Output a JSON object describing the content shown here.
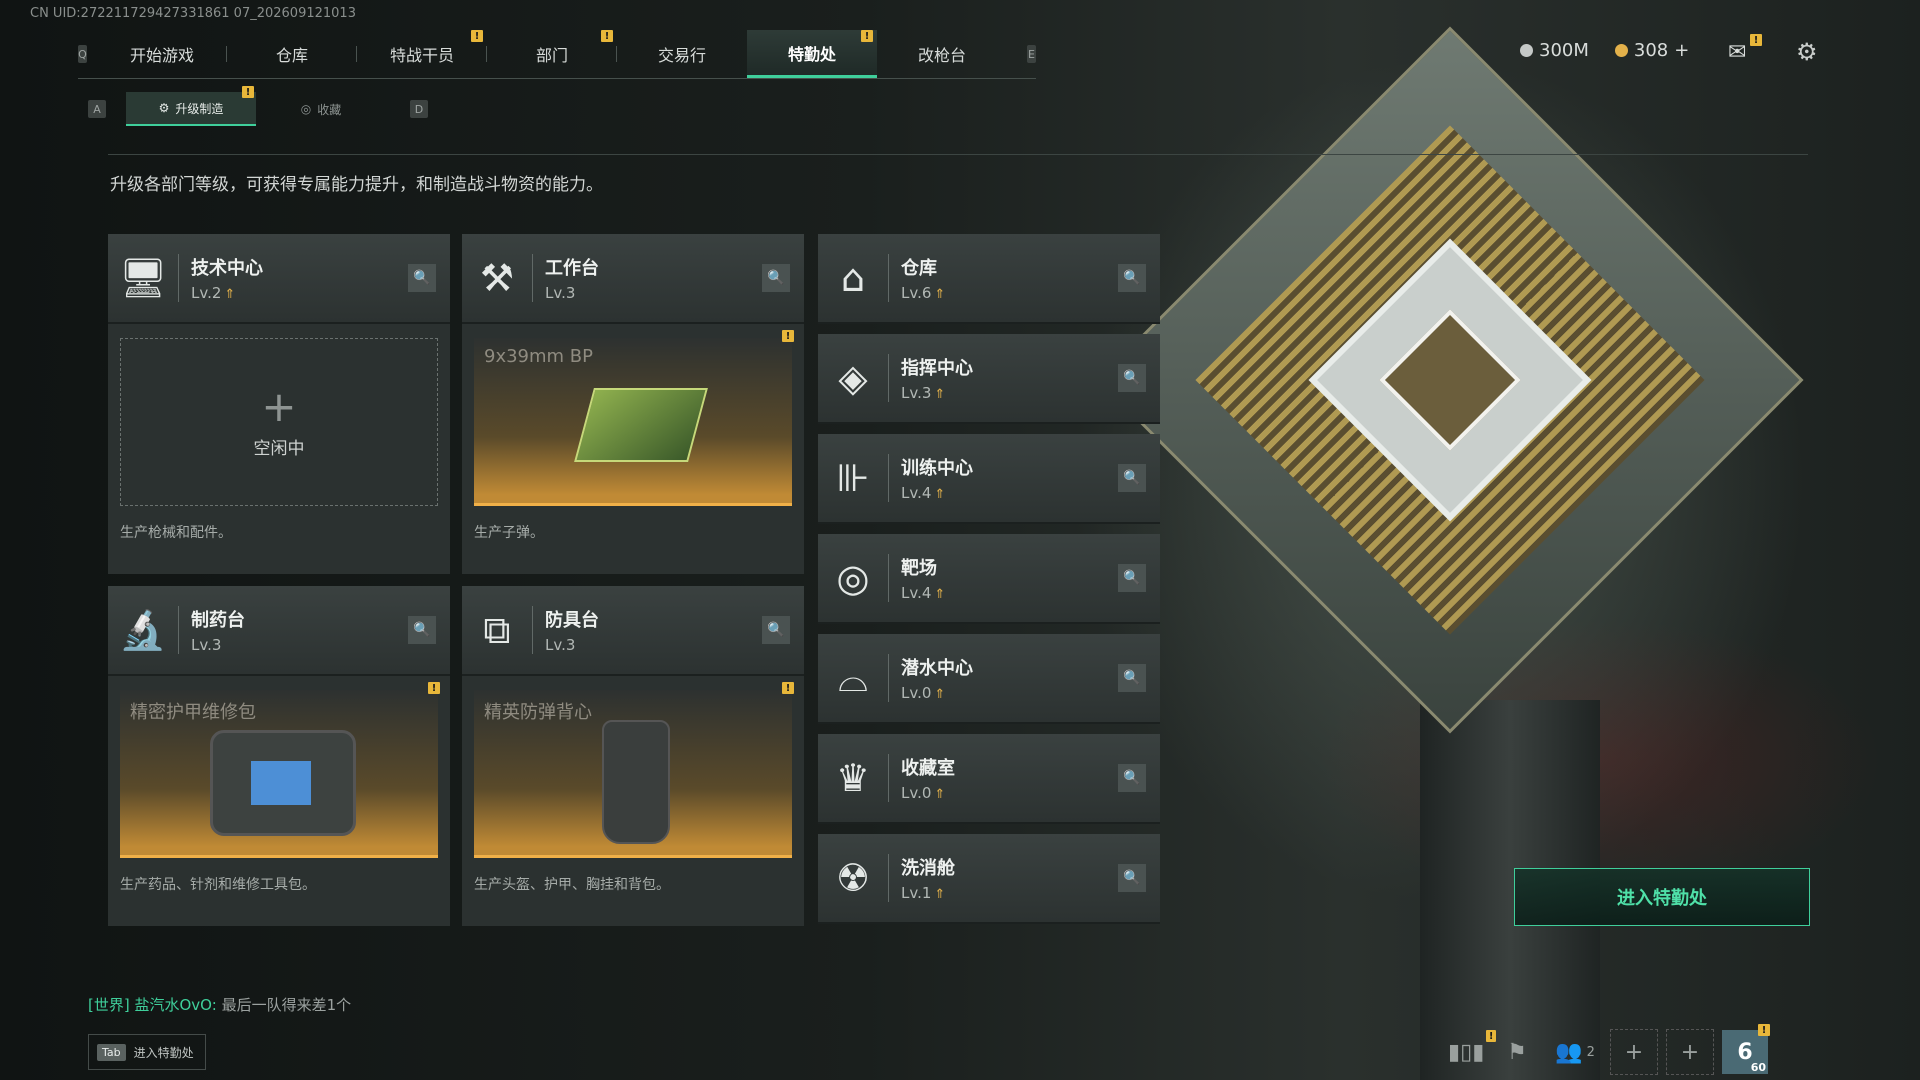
{
  "uid": "CN UID:272211729427331861 07_202609121013",
  "nav": {
    "left_key": "Q",
    "right_key": "E",
    "tabs": [
      {
        "label": "开始游戏",
        "badge": ""
      },
      {
        "label": "仓库",
        "badge": ""
      },
      {
        "label": "特战干员",
        "badge": "!"
      },
      {
        "label": "部门",
        "badge": "!"
      },
      {
        "label": "交易行",
        "badge": ""
      },
      {
        "label": "特勤处",
        "badge": "!",
        "active": true
      },
      {
        "label": "改枪台",
        "badge": ""
      }
    ]
  },
  "subnav": {
    "left_key": "A",
    "right_key": "D",
    "tabs": [
      {
        "label": "升级制造",
        "active": true,
        "badge": "!"
      },
      {
        "label": "收藏",
        "active": false
      }
    ]
  },
  "intro": "升级各部门等级，可获得专属能力提升，和制造战斗物资的能力。",
  "workshops": [
    {
      "name": "技术中心",
      "level": "Lv.2",
      "upgradable": true,
      "icon": "computer-icon",
      "slot_state": "idle",
      "slot_label": "空闲中",
      "desc": "生产枪械和配件。"
    },
    {
      "name": "工作台",
      "level": "Lv.3",
      "upgradable": false,
      "icon": "hammer-wrench-icon",
      "slot_state": "item",
      "slot_label": "9x39mm BP",
      "desc": "生产子弹。"
    },
    {
      "name": "制药台",
      "level": "Lv.3",
      "upgradable": false,
      "icon": "microscope-icon",
      "slot_state": "item",
      "slot_label": "精密护甲维修包",
      "desc": "生产药品、针剂和维修工具包。"
    },
    {
      "name": "防具台",
      "level": "Lv.3",
      "upgradable": false,
      "icon": "boxes-icon",
      "slot_state": "item",
      "slot_label": "精英防弹背心",
      "desc": "生产头盔、护甲、胸挂和背包。"
    }
  ],
  "departments": [
    {
      "name": "仓库",
      "level": "Lv.6",
      "icon": "storage-icon"
    },
    {
      "name": "指挥中心",
      "level": "Lv.3",
      "icon": "command-icon"
    },
    {
      "name": "训练中心",
      "level": "Lv.4",
      "icon": "dumbbell-icon"
    },
    {
      "name": "靶场",
      "level": "Lv.4",
      "icon": "target-icon"
    },
    {
      "name": "潜水中心",
      "level": "Lv.0",
      "icon": "goggles-icon"
    },
    {
      "name": "收藏室",
      "level": "Lv.0",
      "icon": "trophy-icon"
    },
    {
      "name": "洗消舱",
      "level": "Lv.1",
      "icon": "decon-icon"
    }
  ],
  "currency": {
    "silver": "300M",
    "gold": "308",
    "gold_add": "+"
  },
  "enter_button": "进入特勤处",
  "chat": {
    "channel": "[世界]",
    "user": "盐汽水OvO:",
    "message": "最后一队得来差1个"
  },
  "tab_hint": {
    "key": "Tab",
    "label": "进入特勤处"
  },
  "bottom": {
    "friends_count": "2",
    "level_top": "6",
    "level_sub": "60"
  },
  "colors": {
    "accent": "#3fcf9b",
    "badge": "#e8b73a",
    "upgrade": "#e3b14a"
  }
}
